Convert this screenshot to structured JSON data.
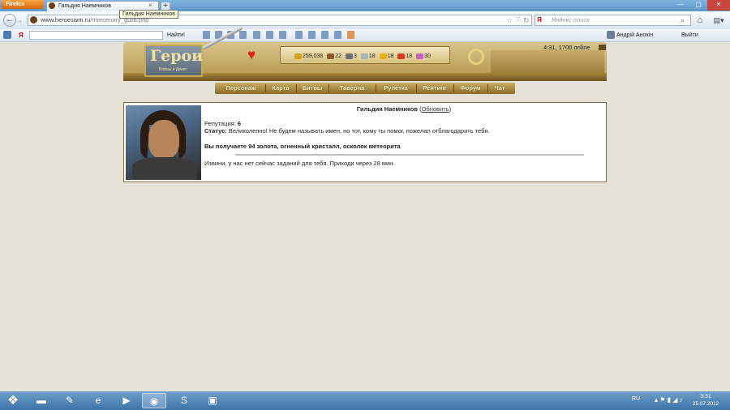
{
  "browser": {
    "firefox_label": "Firefox",
    "tab_title": "Гильдия Наемников",
    "tooltip": "Гильдия Наемников",
    "new_tab": "+",
    "url_domain": "www.heroeswm.ru",
    "url_path": "/mercenary_guild.php",
    "search_placeholder": "Яндекс поиск",
    "search_engine": "Я"
  },
  "yandex_toolbar": {
    "logo": "Я",
    "find_label": "Найти!",
    "user_name": "Андрiй Анохiн",
    "exit_label": "Выйти"
  },
  "game_header": {
    "logo_title": "Герои",
    "logo_subtitle": "Войны и Денег",
    "resources": [
      {
        "name": "gold",
        "value": "259,038",
        "color": "#d4a11c"
      },
      {
        "name": "wood",
        "value": "22",
        "color": "#8a5a2b"
      },
      {
        "name": "ore",
        "value": "3",
        "color": "#6f6f6f"
      },
      {
        "name": "mercury",
        "value": "18",
        "color": "#a9b3bd"
      },
      {
        "name": "sulfur",
        "value": "18",
        "color": "#e0b21b"
      },
      {
        "name": "crystals",
        "value": "18",
        "color": "#d83a1f"
      },
      {
        "name": "gems",
        "value": "30",
        "color": "#c85fcf"
      }
    ],
    "online_status": "4:31, 1700 online",
    "menu": [
      "Персонаж",
      "Карта",
      "Битвы",
      "Таверна",
      "Рулетка",
      "Рейтинг",
      "Форум",
      "Чат"
    ]
  },
  "guild": {
    "title": "Гильдия Наемников",
    "refresh_label": "Обновить",
    "reputation_label": "Репутация:",
    "reputation_value": "6",
    "status_label": "Статус:",
    "status_text": "Великолепно! Не будем называть имен, но тот, кому ты помог, пожелал отблагодарить тебя.",
    "reward_text": "Вы получаете 94 золота, огненный кристалл, осколок метеорита",
    "no_tasks_text": "Извини, у нас нет сейчас заданий для тебя. Приходи через 28 мин."
  },
  "taskbar": {
    "language": "RU",
    "time": "3:31",
    "date": "25.07.2012"
  }
}
